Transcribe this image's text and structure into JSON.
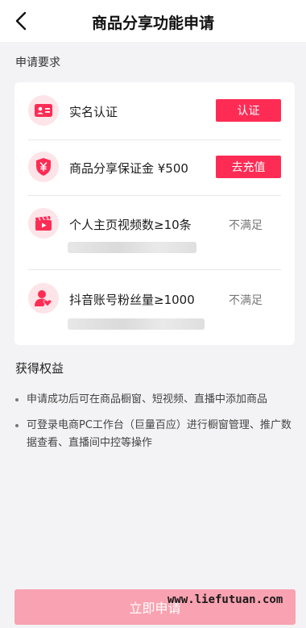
{
  "header": {
    "title": "商品分享功能申请"
  },
  "requirements": {
    "section_title": "申请要求",
    "items": [
      {
        "icon": "id-card-icon",
        "label": "实名认证",
        "action": "认证"
      },
      {
        "icon": "shield-yen-icon",
        "label": "商品分享保证金 ¥500",
        "action": "去充值"
      },
      {
        "icon": "video-clapper-icon",
        "label": "个人主页视频数≥10条",
        "status": "不满足"
      },
      {
        "icon": "user-heart-icon",
        "label": "抖音账号粉丝量≥1000",
        "status": "不满足"
      }
    ]
  },
  "benefits": {
    "section_title": "获得权益",
    "items": [
      "申请成功后可在商品橱窗、短视频、直播中添加商品",
      "可登录电商PC工作台（巨量百应）进行橱窗管理、推广数据查看、直播间中控等操作"
    ]
  },
  "footer": {
    "apply_label": "立即申请",
    "watermark": "www.liefutuan.com"
  },
  "colors": {
    "accent": "#fe2c55",
    "accent_light": "#fde4e8",
    "button_disabled": "#f9a2b1",
    "background": "#f3f3f5"
  }
}
